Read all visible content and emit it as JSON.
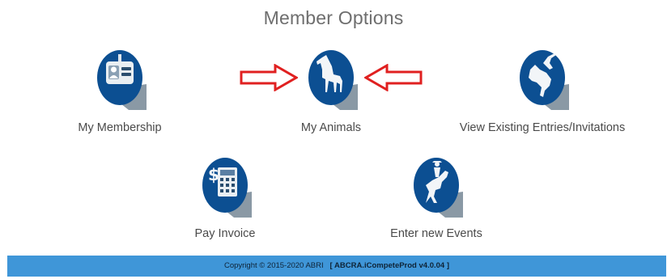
{
  "header": {
    "title": "Member Options"
  },
  "options": [
    {
      "label": "My Membership",
      "icon": "id-badge-icon"
    },
    {
      "label": "My Animals",
      "icon": "horse-icon"
    },
    {
      "label": "View Existing Entries/Invitations",
      "icon": "bull-rider-icon"
    },
    {
      "label": "Pay Invoice",
      "icon": "invoice-calculator-icon"
    },
    {
      "label": "Enter new Events",
      "icon": "bronc-rider-icon"
    }
  ],
  "annotations": {
    "arrow_color": "#e02020"
  },
  "colors": {
    "icon_circle": "#0c4f92",
    "icon_shadow": "#6d7f8e",
    "footer_bg": "#3f96d8"
  },
  "footer": {
    "copyright": "Copyright © 2015-2020 ABRI",
    "version": "[ ABCRA.iCompeteProd v4.0.04 ]"
  }
}
